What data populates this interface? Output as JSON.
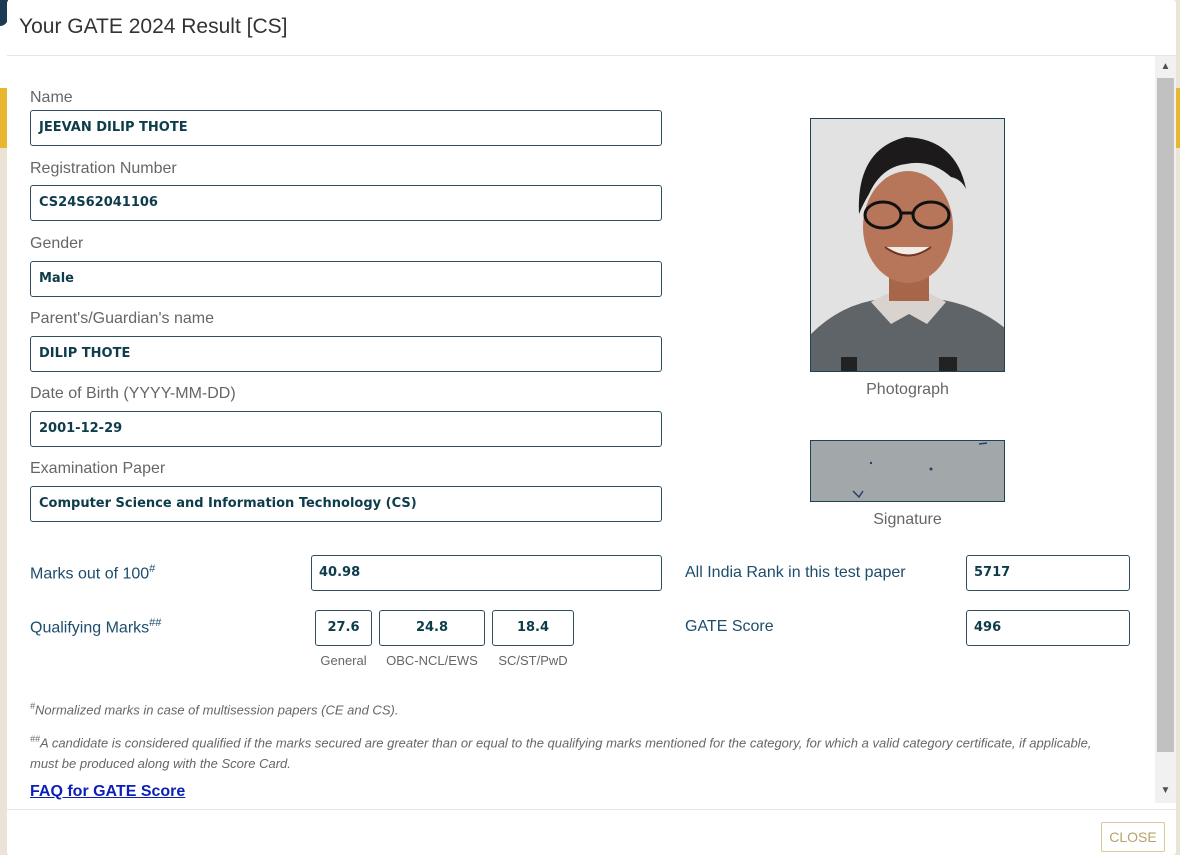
{
  "modal": {
    "title": "Your GATE 2024 Result [CS]",
    "close_label": "CLOSE"
  },
  "fields": [
    {
      "label": "Name",
      "value": "JEEVAN DILIP THOTE"
    },
    {
      "label": "Registration Number",
      "value": "CS24S62041106"
    },
    {
      "label": "Gender",
      "value": "Male"
    },
    {
      "label": "Parent's/Guardian's name",
      "value": "DILIP THOTE"
    },
    {
      "label": "Date of Birth (YYYY-MM-DD)",
      "value": "2001-12-29"
    },
    {
      "label": "Examination Paper",
      "value": "Computer Science and Information Technology (CS)"
    }
  ],
  "photo": {
    "caption": "Photograph"
  },
  "signature": {
    "caption": "Signature"
  },
  "marks": {
    "label": "Marks out of 100",
    "sup": "#",
    "value": "40.98"
  },
  "qualifying": {
    "label": "Qualifying Marks",
    "sup": "##",
    "general": {
      "value": "27.6",
      "caption": "General"
    },
    "obc": {
      "value": "24.8",
      "caption": "OBC-NCL/EWS"
    },
    "sc": {
      "value": "18.4",
      "caption": "SC/ST/PwD"
    }
  },
  "rank": {
    "label": "All India Rank in this test paper",
    "value": "5717"
  },
  "score": {
    "label": "GATE Score",
    "value": "496"
  },
  "notes": {
    "note1_sup": "#",
    "note1": "Normalized marks in case of multisession papers (CE and CS).",
    "note2_sup": "##",
    "note2": "A candidate is considered qualified if the marks secured are greater than or equal to the qualifying marks mentioned for the category, for which a valid category certificate, if applicable, must be produced along with the Score Card."
  },
  "faq_link": "FAQ for GATE Score"
}
